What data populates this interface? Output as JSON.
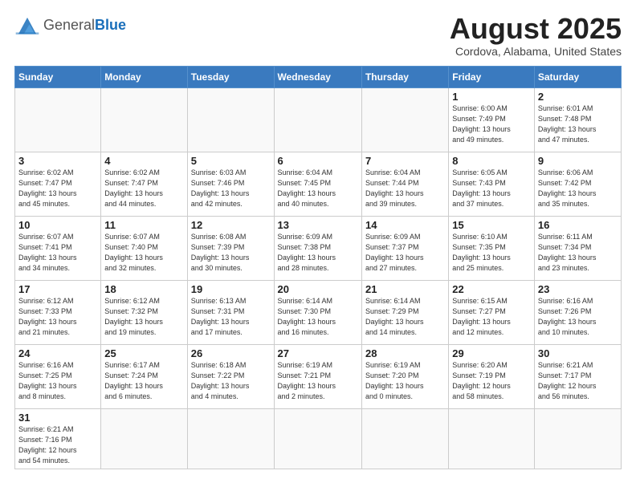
{
  "header": {
    "logo_general": "General",
    "logo_blue": "Blue",
    "month_year": "August 2025",
    "location": "Cordova, Alabama, United States"
  },
  "weekdays": [
    "Sunday",
    "Monday",
    "Tuesday",
    "Wednesday",
    "Thursday",
    "Friday",
    "Saturday"
  ],
  "weeks": [
    [
      {
        "day": "",
        "info": ""
      },
      {
        "day": "",
        "info": ""
      },
      {
        "day": "",
        "info": ""
      },
      {
        "day": "",
        "info": ""
      },
      {
        "day": "",
        "info": ""
      },
      {
        "day": "1",
        "info": "Sunrise: 6:00 AM\nSunset: 7:49 PM\nDaylight: 13 hours\nand 49 minutes."
      },
      {
        "day": "2",
        "info": "Sunrise: 6:01 AM\nSunset: 7:48 PM\nDaylight: 13 hours\nand 47 minutes."
      }
    ],
    [
      {
        "day": "3",
        "info": "Sunrise: 6:02 AM\nSunset: 7:47 PM\nDaylight: 13 hours\nand 45 minutes."
      },
      {
        "day": "4",
        "info": "Sunrise: 6:02 AM\nSunset: 7:47 PM\nDaylight: 13 hours\nand 44 minutes."
      },
      {
        "day": "5",
        "info": "Sunrise: 6:03 AM\nSunset: 7:46 PM\nDaylight: 13 hours\nand 42 minutes."
      },
      {
        "day": "6",
        "info": "Sunrise: 6:04 AM\nSunset: 7:45 PM\nDaylight: 13 hours\nand 40 minutes."
      },
      {
        "day": "7",
        "info": "Sunrise: 6:04 AM\nSunset: 7:44 PM\nDaylight: 13 hours\nand 39 minutes."
      },
      {
        "day": "8",
        "info": "Sunrise: 6:05 AM\nSunset: 7:43 PM\nDaylight: 13 hours\nand 37 minutes."
      },
      {
        "day": "9",
        "info": "Sunrise: 6:06 AM\nSunset: 7:42 PM\nDaylight: 13 hours\nand 35 minutes."
      }
    ],
    [
      {
        "day": "10",
        "info": "Sunrise: 6:07 AM\nSunset: 7:41 PM\nDaylight: 13 hours\nand 34 minutes."
      },
      {
        "day": "11",
        "info": "Sunrise: 6:07 AM\nSunset: 7:40 PM\nDaylight: 13 hours\nand 32 minutes."
      },
      {
        "day": "12",
        "info": "Sunrise: 6:08 AM\nSunset: 7:39 PM\nDaylight: 13 hours\nand 30 minutes."
      },
      {
        "day": "13",
        "info": "Sunrise: 6:09 AM\nSunset: 7:38 PM\nDaylight: 13 hours\nand 28 minutes."
      },
      {
        "day": "14",
        "info": "Sunrise: 6:09 AM\nSunset: 7:37 PM\nDaylight: 13 hours\nand 27 minutes."
      },
      {
        "day": "15",
        "info": "Sunrise: 6:10 AM\nSunset: 7:35 PM\nDaylight: 13 hours\nand 25 minutes."
      },
      {
        "day": "16",
        "info": "Sunrise: 6:11 AM\nSunset: 7:34 PM\nDaylight: 13 hours\nand 23 minutes."
      }
    ],
    [
      {
        "day": "17",
        "info": "Sunrise: 6:12 AM\nSunset: 7:33 PM\nDaylight: 13 hours\nand 21 minutes."
      },
      {
        "day": "18",
        "info": "Sunrise: 6:12 AM\nSunset: 7:32 PM\nDaylight: 13 hours\nand 19 minutes."
      },
      {
        "day": "19",
        "info": "Sunrise: 6:13 AM\nSunset: 7:31 PM\nDaylight: 13 hours\nand 17 minutes."
      },
      {
        "day": "20",
        "info": "Sunrise: 6:14 AM\nSunset: 7:30 PM\nDaylight: 13 hours\nand 16 minutes."
      },
      {
        "day": "21",
        "info": "Sunrise: 6:14 AM\nSunset: 7:29 PM\nDaylight: 13 hours\nand 14 minutes."
      },
      {
        "day": "22",
        "info": "Sunrise: 6:15 AM\nSunset: 7:27 PM\nDaylight: 13 hours\nand 12 minutes."
      },
      {
        "day": "23",
        "info": "Sunrise: 6:16 AM\nSunset: 7:26 PM\nDaylight: 13 hours\nand 10 minutes."
      }
    ],
    [
      {
        "day": "24",
        "info": "Sunrise: 6:16 AM\nSunset: 7:25 PM\nDaylight: 13 hours\nand 8 minutes."
      },
      {
        "day": "25",
        "info": "Sunrise: 6:17 AM\nSunset: 7:24 PM\nDaylight: 13 hours\nand 6 minutes."
      },
      {
        "day": "26",
        "info": "Sunrise: 6:18 AM\nSunset: 7:22 PM\nDaylight: 13 hours\nand 4 minutes."
      },
      {
        "day": "27",
        "info": "Sunrise: 6:19 AM\nSunset: 7:21 PM\nDaylight: 13 hours\nand 2 minutes."
      },
      {
        "day": "28",
        "info": "Sunrise: 6:19 AM\nSunset: 7:20 PM\nDaylight: 13 hours\nand 0 minutes."
      },
      {
        "day": "29",
        "info": "Sunrise: 6:20 AM\nSunset: 7:19 PM\nDaylight: 12 hours\nand 58 minutes."
      },
      {
        "day": "30",
        "info": "Sunrise: 6:21 AM\nSunset: 7:17 PM\nDaylight: 12 hours\nand 56 minutes."
      }
    ],
    [
      {
        "day": "31",
        "info": "Sunrise: 6:21 AM\nSunset: 7:16 PM\nDaylight: 12 hours\nand 54 minutes."
      },
      {
        "day": "",
        "info": ""
      },
      {
        "day": "",
        "info": ""
      },
      {
        "day": "",
        "info": ""
      },
      {
        "day": "",
        "info": ""
      },
      {
        "day": "",
        "info": ""
      },
      {
        "day": "",
        "info": ""
      }
    ]
  ]
}
